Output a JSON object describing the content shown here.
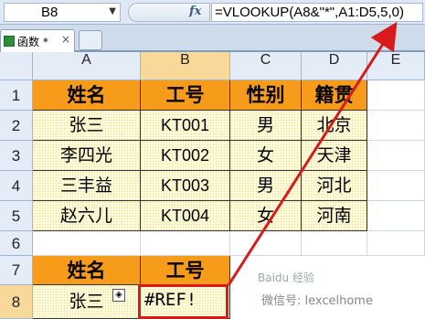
{
  "formula_bar": {
    "name_box": "B8",
    "fx_label": "fx",
    "formula": "=VLOOKUP(A8&\"*\",A1:D5,5,0)"
  },
  "sheet_tab": {
    "label": "函数 *",
    "close": "×"
  },
  "columns": [
    "A",
    "B",
    "C",
    "D",
    "E"
  ],
  "rows": [
    "1",
    "2",
    "3",
    "4",
    "5",
    "6",
    "7",
    "8"
  ],
  "table1": {
    "headers": [
      "姓名",
      "工号",
      "性别",
      "籍贯"
    ],
    "rows": [
      [
        "张三",
        "KT001",
        "男",
        "北京"
      ],
      [
        "李四光",
        "KT002",
        "女",
        "天津"
      ],
      [
        "三丰益",
        "KT003",
        "男",
        "河北"
      ],
      [
        "赵六儿",
        "KT004",
        "女",
        "河南"
      ]
    ]
  },
  "table2": {
    "headers": [
      "姓名",
      "工号"
    ],
    "row": [
      "张三",
      "#REF!"
    ]
  },
  "watermark": "Baidu 经验",
  "wechat": "微信号: lexcelhome",
  "colors": {
    "header_fill": "#f79b1a",
    "data_fill": "#fffbd8",
    "highlight": "#d81a1a",
    "selected_header": "#f9d99a"
  }
}
